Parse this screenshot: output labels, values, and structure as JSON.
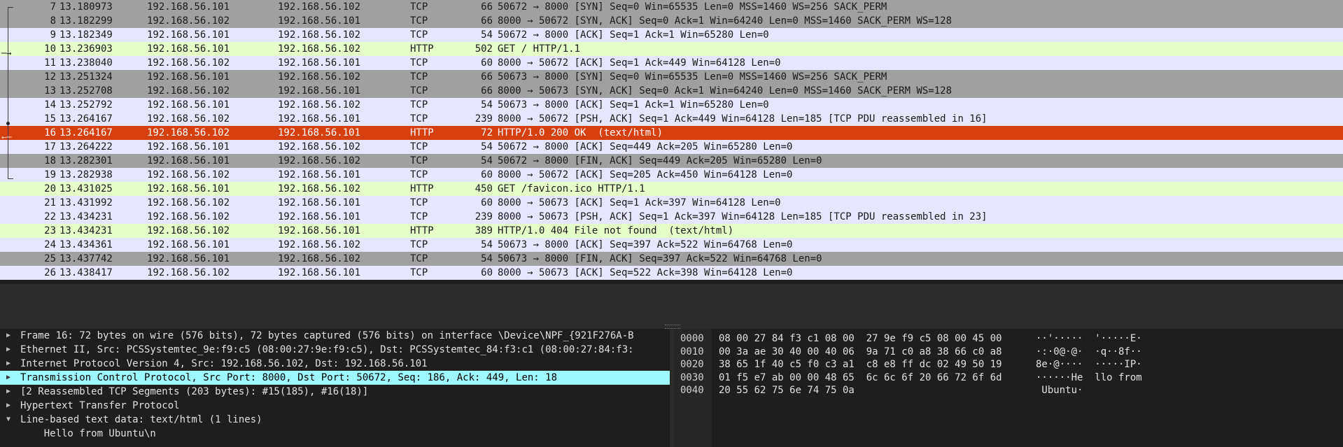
{
  "packets": [
    {
      "no": "7",
      "time": "13.180973",
      "src": "192.168.56.101",
      "dst": "192.168.56.102",
      "proto": "TCP",
      "len": "66",
      "info": "50672 → 8000 [SYN] Seq=0 Win=65535 Len=0 MSS=1460 WS=256 SACK_PERM",
      "style": "tcp-b"
    },
    {
      "no": "8",
      "time": "13.182299",
      "src": "192.168.56.102",
      "dst": "192.168.56.101",
      "proto": "TCP",
      "len": "66",
      "info": "8000 → 50672 [SYN, ACK] Seq=0 Ack=1 Win=64240 Len=0 MSS=1460 SACK_PERM WS=128",
      "style": "tcp-b"
    },
    {
      "no": "9",
      "time": "13.182349",
      "src": "192.168.56.101",
      "dst": "192.168.56.102",
      "proto": "TCP",
      "len": "54",
      "info": "50672 → 8000 [ACK] Seq=1 Ack=1 Win=65280 Len=0",
      "style": "tcp-a"
    },
    {
      "no": "10",
      "time": "13.236903",
      "src": "192.168.56.101",
      "dst": "192.168.56.102",
      "proto": "HTTP",
      "len": "502",
      "info": "GET / HTTP/1.1",
      "style": "http"
    },
    {
      "no": "11",
      "time": "13.238040",
      "src": "192.168.56.102",
      "dst": "192.168.56.101",
      "proto": "TCP",
      "len": "60",
      "info": "8000 → 50672 [ACK] Seq=1 Ack=449 Win=64128 Len=0",
      "style": "tcp-a"
    },
    {
      "no": "12",
      "time": "13.251324",
      "src": "192.168.56.101",
      "dst": "192.168.56.102",
      "proto": "TCP",
      "len": "66",
      "info": "50673 → 8000 [SYN] Seq=0 Win=65535 Len=0 MSS=1460 WS=256 SACK_PERM",
      "style": "tcp-b"
    },
    {
      "no": "13",
      "time": "13.252708",
      "src": "192.168.56.102",
      "dst": "192.168.56.101",
      "proto": "TCP",
      "len": "66",
      "info": "8000 → 50673 [SYN, ACK] Seq=0 Ack=1 Win=64240 Len=0 MSS=1460 SACK_PERM WS=128",
      "style": "tcp-b"
    },
    {
      "no": "14",
      "time": "13.252792",
      "src": "192.168.56.101",
      "dst": "192.168.56.102",
      "proto": "TCP",
      "len": "54",
      "info": "50673 → 8000 [ACK] Seq=1 Ack=1 Win=65280 Len=0",
      "style": "tcp-a"
    },
    {
      "no": "15",
      "time": "13.264167",
      "src": "192.168.56.102",
      "dst": "192.168.56.101",
      "proto": "TCP",
      "len": "239",
      "info": "8000 → 50672 [PSH, ACK] Seq=1 Ack=449 Win=64128 Len=185 [TCP PDU reassembled in 16]",
      "style": "tcp-a"
    },
    {
      "no": "16",
      "time": "13.264167",
      "src": "192.168.56.102",
      "dst": "192.168.56.101",
      "proto": "HTTP",
      "len": "72",
      "info": "HTTP/1.0 200 OK  (text/html)",
      "style": "sel"
    },
    {
      "no": "17",
      "time": "13.264222",
      "src": "192.168.56.101",
      "dst": "192.168.56.102",
      "proto": "TCP",
      "len": "54",
      "info": "50672 → 8000 [ACK] Seq=449 Ack=205 Win=65280 Len=0",
      "style": "tcp-a"
    },
    {
      "no": "18",
      "time": "13.282301",
      "src": "192.168.56.101",
      "dst": "192.168.56.102",
      "proto": "TCP",
      "len": "54",
      "info": "50672 → 8000 [FIN, ACK] Seq=449 Ack=205 Win=65280 Len=0",
      "style": "tcp-b"
    },
    {
      "no": "19",
      "time": "13.282938",
      "src": "192.168.56.102",
      "dst": "192.168.56.101",
      "proto": "TCP",
      "len": "60",
      "info": "8000 → 50672 [ACK] Seq=205 Ack=450 Win=64128 Len=0",
      "style": "tcp-a"
    },
    {
      "no": "20",
      "time": "13.431025",
      "src": "192.168.56.101",
      "dst": "192.168.56.102",
      "proto": "HTTP",
      "len": "450",
      "info": "GET /favicon.ico HTTP/1.1",
      "style": "http"
    },
    {
      "no": "21",
      "time": "13.431992",
      "src": "192.168.56.102",
      "dst": "192.168.56.101",
      "proto": "TCP",
      "len": "60",
      "info": "8000 → 50673 [ACK] Seq=1 Ack=397 Win=64128 Len=0",
      "style": "tcp-a"
    },
    {
      "no": "22",
      "time": "13.434231",
      "src": "192.168.56.102",
      "dst": "192.168.56.101",
      "proto": "TCP",
      "len": "239",
      "info": "8000 → 50673 [PSH, ACK] Seq=1 Ack=397 Win=64128 Len=185 [TCP PDU reassembled in 23]",
      "style": "tcp-a"
    },
    {
      "no": "23",
      "time": "13.434231",
      "src": "192.168.56.102",
      "dst": "192.168.56.101",
      "proto": "HTTP",
      "len": "389",
      "info": "HTTP/1.0 404 File not found  (text/html)",
      "style": "http"
    },
    {
      "no": "24",
      "time": "13.434361",
      "src": "192.168.56.101",
      "dst": "192.168.56.102",
      "proto": "TCP",
      "len": "54",
      "info": "50673 → 8000 [ACK] Seq=397 Ack=522 Win=64768 Len=0",
      "style": "tcp-a"
    },
    {
      "no": "25",
      "time": "13.437742",
      "src": "192.168.56.101",
      "dst": "192.168.56.102",
      "proto": "TCP",
      "len": "54",
      "info": "50673 → 8000 [FIN, ACK] Seq=397 Ack=522 Win=64768 Len=0",
      "style": "tcp-b"
    },
    {
      "no": "26",
      "time": "13.438417",
      "src": "192.168.56.102",
      "dst": "192.168.56.101",
      "proto": "TCP",
      "len": "60",
      "info": "8000 → 50673 [ACK] Seq=522 Ack=398 Win=64128 Len=0",
      "style": "tcp-a"
    }
  ],
  "details": [
    {
      "arrow": "▶",
      "text": "Frame 16: 72 bytes on wire (576 bits), 72 bytes captured (576 bits) on interface \\Device\\NPF_{921F276A-B",
      "hl": false
    },
    {
      "arrow": "▶",
      "text": "Ethernet II, Src: PCSSystemtec_9e:f9:c5 (08:00:27:9e:f9:c5), Dst: PCSSystemtec_84:f3:c1 (08:00:27:84:f3:",
      "hl": false
    },
    {
      "arrow": "▶",
      "text": "Internet Protocol Version 4, Src: 192.168.56.102, Dst: 192.168.56.101",
      "hl": false
    },
    {
      "arrow": "▶",
      "text": "Transmission Control Protocol, Src Port: 8000, Dst Port: 50672, Seq: 186, Ack: 449, Len: 18",
      "hl": true
    },
    {
      "arrow": "▶",
      "text": "[2 Reassembled TCP Segments (203 bytes): #15(185), #16(18)]",
      "hl": false
    },
    {
      "arrow": "▶",
      "text": "Hypertext Transfer Protocol",
      "hl": false
    },
    {
      "arrow": "▼",
      "text": "Line-based text data: text/html (1 lines)",
      "hl": false
    },
    {
      "arrow": "",
      "text": "    Hello from Ubuntu\\n",
      "hl": false
    }
  ],
  "bytes": [
    {
      "offset": "0000",
      "hex": "08 00 27 84 f3 c1 08 00  27 9e f9 c5 08 00 45 00",
      "ascii": "··'·····  '·····E·"
    },
    {
      "offset": "0010",
      "hex": "00 3a ae 30 40 00 40 06  9a 71 c0 a8 38 66 c0 a8",
      "ascii": "·:·0@·@·  ·q··8f··"
    },
    {
      "offset": "0020",
      "hex": "38 65 1f 40 c5 f0 c3 a1  c8 e8 ff dc 02 49 50 19",
      "ascii": "8e·@····  ·····IP·"
    },
    {
      "offset": "0030",
      "hex": "01 f5 e7 ab 00 00 48 65  6c 6c 6f 20 66 72 6f 6d",
      "ascii": "······He  llo from"
    },
    {
      "offset": "0040",
      "hex": "20 55 62 75 6e 74 75 0a",
      "ascii": " Ubuntu·"
    }
  ]
}
